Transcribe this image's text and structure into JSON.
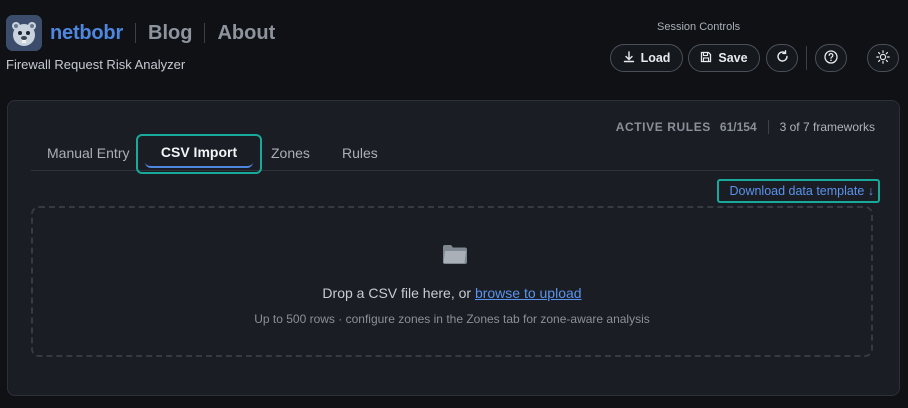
{
  "header": {
    "brand": "netbobr",
    "nav": [
      "Blog",
      "About"
    ],
    "subtitle": "Firewall Request Risk Analyzer"
  },
  "session": {
    "label": "Session Controls",
    "load": "Load",
    "save": "Save"
  },
  "stats": {
    "label": "ACTIVE RULES",
    "value": "61/154",
    "frameworks": "3 of 7 frameworks"
  },
  "tabs": {
    "manual": "Manual Entry",
    "csv": "CSV Import",
    "zones": "Zones",
    "rules": "Rules",
    "active": "CSV Import"
  },
  "template_link": "Download data template ↓",
  "dropzone": {
    "text_before": "Drop a CSV file here, or ",
    "browse": "browse to upload",
    "hint": "Up to 500 rows · configure zones in the Zones tab for zone-aware analysis"
  },
  "icons": {
    "logo": "beaver-logo-icon",
    "load": "download-icon",
    "save": "floppy-disk-icon",
    "refresh": "refresh-icon",
    "help": "question-circle-icon",
    "theme": "sun-icon",
    "folder": "folder-icon"
  },
  "colors": {
    "accent": "#4f86e0",
    "highlight": "#17a99a",
    "link": "#5b93ec"
  }
}
